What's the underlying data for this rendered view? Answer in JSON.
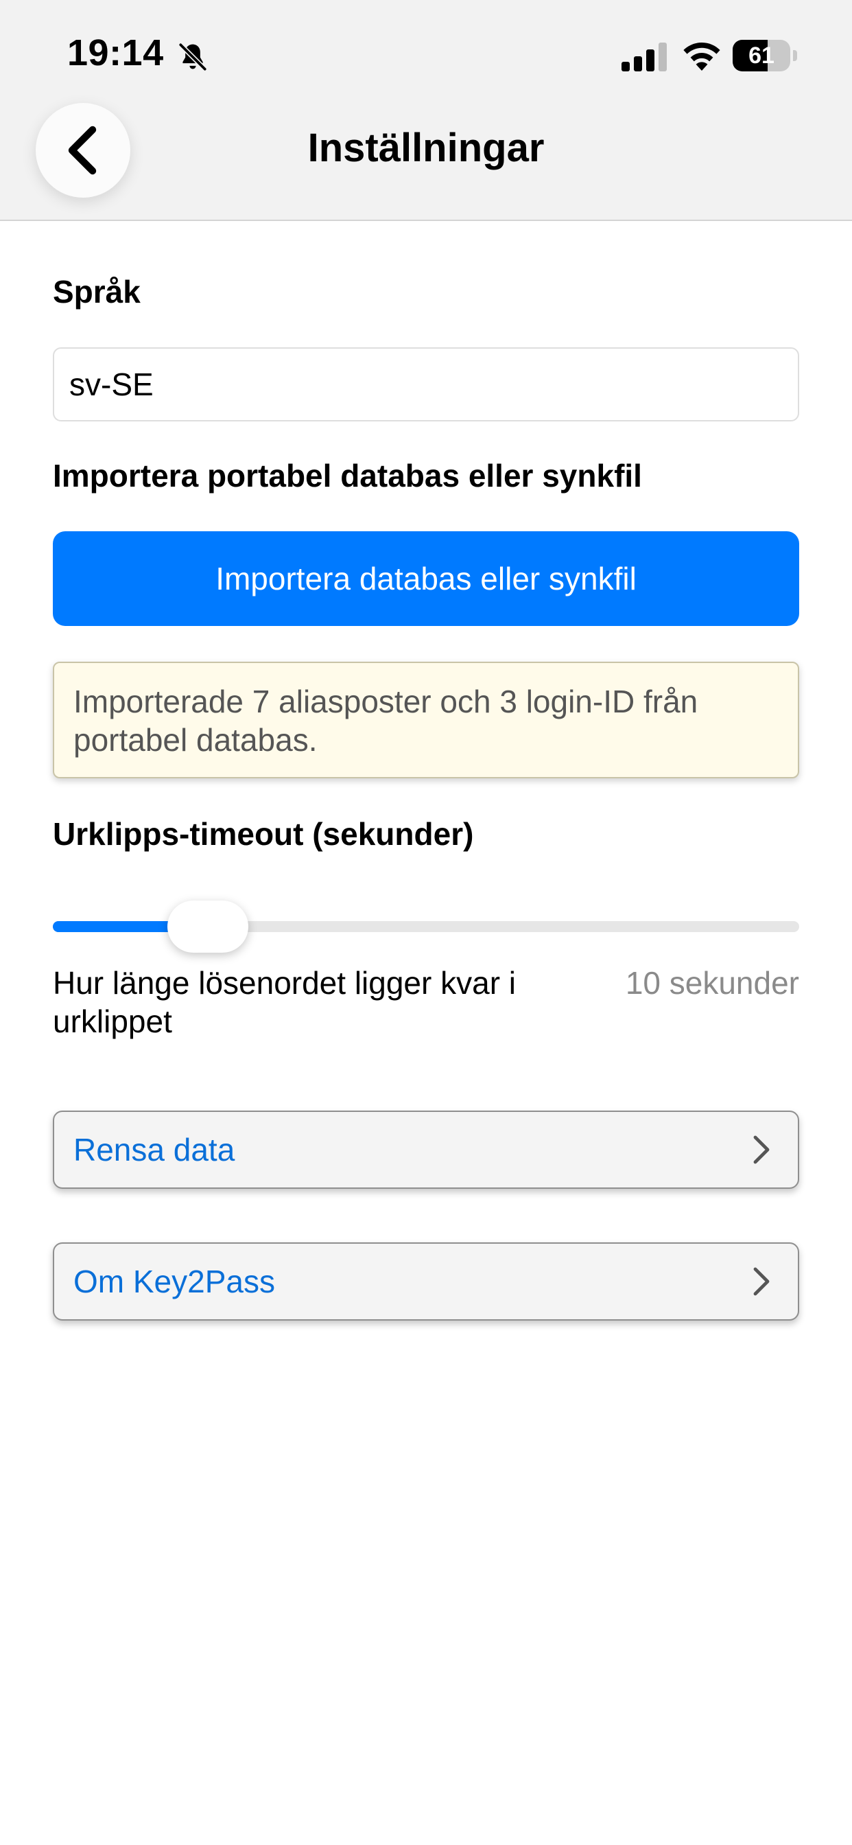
{
  "status_bar": {
    "time": "19:14",
    "battery_level": "61",
    "battery_fraction": 0.61,
    "icons": [
      "bell-slash-icon",
      "cellular-signal-icon",
      "wifi-icon",
      "battery-icon"
    ]
  },
  "header": {
    "title": "Inställningar",
    "back_icon": "chevron-left-icon"
  },
  "language": {
    "label": "Språk",
    "value": "sv-SE"
  },
  "import": {
    "label": "Importera portabel databas eller synkfil",
    "button_label": "Importera databas eller synkfil",
    "notice": "Importerade 7 aliasposter och 3 login-ID från portabel databas."
  },
  "clipboard": {
    "label": "Urklipps-timeout (sekunder)",
    "description": "Hur länge lösenordet ligger kvar i urklippet",
    "value_text": "10 sekunder",
    "slider_fraction": 0.2
  },
  "nav_rows": [
    {
      "label": "Rensa data",
      "icon": "chevron-right-icon"
    },
    {
      "label": "Om Key2Pass",
      "icon": "chevron-right-icon"
    }
  ],
  "colors": {
    "accent": "#007aff",
    "link": "#0a6fd8",
    "notice_bg": "#fffbea",
    "secondary_text": "#8a8a8a"
  }
}
